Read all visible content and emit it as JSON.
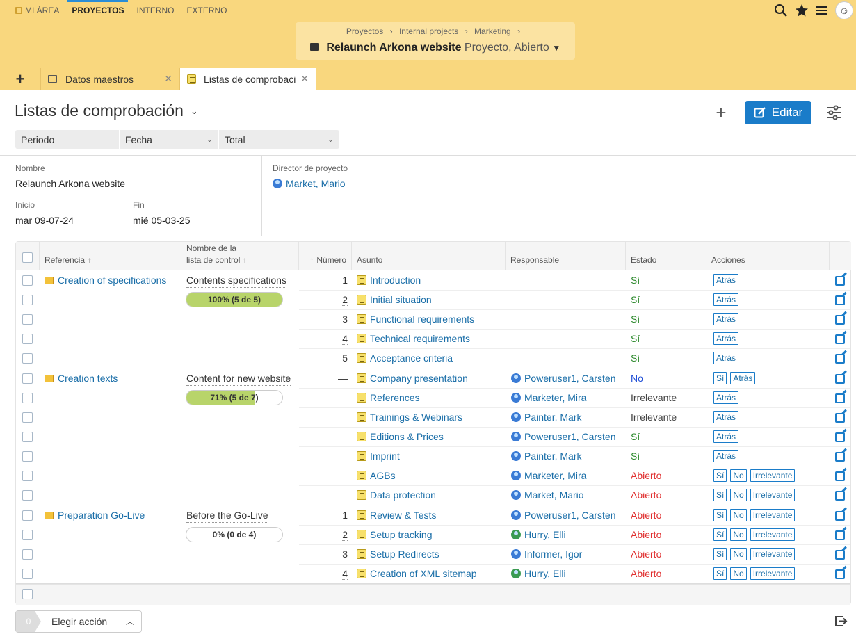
{
  "nav": {
    "items": [
      "MI ÁREA",
      "PROYECTOS",
      "INTERNO",
      "EXTERNO"
    ]
  },
  "context": {
    "breadcrumbs": [
      "Proyectos",
      "Internal projects",
      "Marketing"
    ],
    "sep": "›",
    "title": "Relaunch Arkona website",
    "subtitle": "Proyecto, Abierto"
  },
  "tabs": [
    "Datos maestros",
    "Listas de comprobación"
  ],
  "page": {
    "title": "Listas de comprobación",
    "edit_label": "Editar"
  },
  "filters": {
    "period_label": "Periodo",
    "date_value": "Fecha",
    "total_value": "Total"
  },
  "meta": {
    "name_label": "Nombre",
    "name_value": "Relaunch Arkona website",
    "director_label": "Director de proyecto",
    "director_value": "Market, Mario",
    "start_label": "Inicio",
    "start_value": "mar 09-07-24",
    "end_label": "Fin",
    "end_value": "mié 05-03-25"
  },
  "table": {
    "columns": {
      "reference": "Referencia",
      "checklist_name_1": "Nombre de la",
      "checklist_name_2": "lista de control",
      "number": "Número",
      "subject": "Asunto",
      "responsible": "Responsable",
      "status": "Estado",
      "actions": "Acciones"
    },
    "groups": [
      {
        "reference": "Creation of specifications",
        "checklist": "Contents specifications",
        "progress_label": "100% (5 de 5)",
        "progress": 1.0,
        "rows": [
          {
            "num": "1",
            "subject": "Introduction",
            "resp": "",
            "resp_color": "",
            "status": "Sí",
            "status_class": "st-si",
            "actions": [
              "Atrás"
            ]
          },
          {
            "num": "2",
            "subject": "Initial situation",
            "resp": "",
            "resp_color": "",
            "status": "Sí",
            "status_class": "st-si",
            "actions": [
              "Atrás"
            ]
          },
          {
            "num": "3",
            "subject": "Functional requirements",
            "resp": "",
            "resp_color": "",
            "status": "Sí",
            "status_class": "st-si",
            "actions": [
              "Atrás"
            ]
          },
          {
            "num": "4",
            "subject": "Technical requirements",
            "resp": "",
            "resp_color": "",
            "status": "Sí",
            "status_class": "st-si",
            "actions": [
              "Atrás"
            ]
          },
          {
            "num": "5",
            "subject": "Acceptance criteria",
            "resp": "",
            "resp_color": "",
            "status": "Sí",
            "status_class": "st-si",
            "actions": [
              "Atrás"
            ]
          }
        ]
      },
      {
        "reference": "Creation texts",
        "checklist": "Content for new website",
        "progress_label": "71% (5 de 7)",
        "progress": 0.71,
        "rows": [
          {
            "num": "—",
            "subject": "Company presentation",
            "resp": "Poweruser1, Carsten",
            "resp_color": "blue",
            "status": "No",
            "status_class": "st-no",
            "actions": [
              "Sí",
              "Atrás"
            ]
          },
          {
            "num": "",
            "subject": "References",
            "resp": "Marketer, Mira",
            "resp_color": "blue",
            "status": "Irrelevante",
            "status_class": "st-irr",
            "actions": [
              "Atrás"
            ]
          },
          {
            "num": "",
            "subject": "Trainings & Webinars",
            "resp": "Painter, Mark",
            "resp_color": "blue",
            "status": "Irrelevante",
            "status_class": "st-irr",
            "actions": [
              "Atrás"
            ]
          },
          {
            "num": "",
            "subject": "Editions & Prices",
            "resp": "Poweruser1, Carsten",
            "resp_color": "blue",
            "status": "Sí",
            "status_class": "st-si",
            "actions": [
              "Atrás"
            ]
          },
          {
            "num": "",
            "subject": "Imprint",
            "resp": "Painter, Mark",
            "resp_color": "blue",
            "status": "Sí",
            "status_class": "st-si",
            "actions": [
              "Atrás"
            ]
          },
          {
            "num": "",
            "subject": "AGBs",
            "resp": "Marketer, Mira",
            "resp_color": "blue",
            "status": "Abierto",
            "status_class": "st-ab",
            "actions": [
              "Sí",
              "No",
              "Irrelevante"
            ]
          },
          {
            "num": "",
            "subject": "Data protection",
            "resp": "Market, Mario",
            "resp_color": "blue",
            "status": "Abierto",
            "status_class": "st-ab",
            "actions": [
              "Sí",
              "No",
              "Irrelevante"
            ]
          }
        ]
      },
      {
        "reference": "Preparation Go-Live",
        "checklist": "Before the Go-Live",
        "progress_label": "0% (0 de 4)",
        "progress": 0.0,
        "rows": [
          {
            "num": "1",
            "subject": "Review & Tests",
            "resp": "Poweruser1, Carsten",
            "resp_color": "blue",
            "status": "Abierto",
            "status_class": "st-ab",
            "actions": [
              "Sí",
              "No",
              "Irrelevante"
            ]
          },
          {
            "num": "2",
            "subject": "Setup tracking",
            "resp": "Hurry, Elli",
            "resp_color": "green",
            "status": "Abierto",
            "status_class": "st-ab",
            "actions": [
              "Sí",
              "No",
              "Irrelevante"
            ]
          },
          {
            "num": "3",
            "subject": "Setup Redirects",
            "resp": "Informer, Igor",
            "resp_color": "blue",
            "status": "Abierto",
            "status_class": "st-ab",
            "actions": [
              "Sí",
              "No",
              "Irrelevante"
            ]
          },
          {
            "num": "4",
            "subject": "Creation of XML sitemap",
            "resp": "Hurry, Elli",
            "resp_color": "green",
            "status": "Abierto",
            "status_class": "st-ab",
            "actions": [
              "Sí",
              "No",
              "Irrelevante"
            ]
          }
        ]
      }
    ]
  },
  "footer": {
    "selected_count": "0",
    "action_label": "Elegir acción"
  },
  "colors": {
    "header_bg": "#f9d77e",
    "accent": "#1a7cc9",
    "status_yes": "#2e8a2e",
    "status_no": "#1f4ed6",
    "status_open": "#e03030"
  }
}
